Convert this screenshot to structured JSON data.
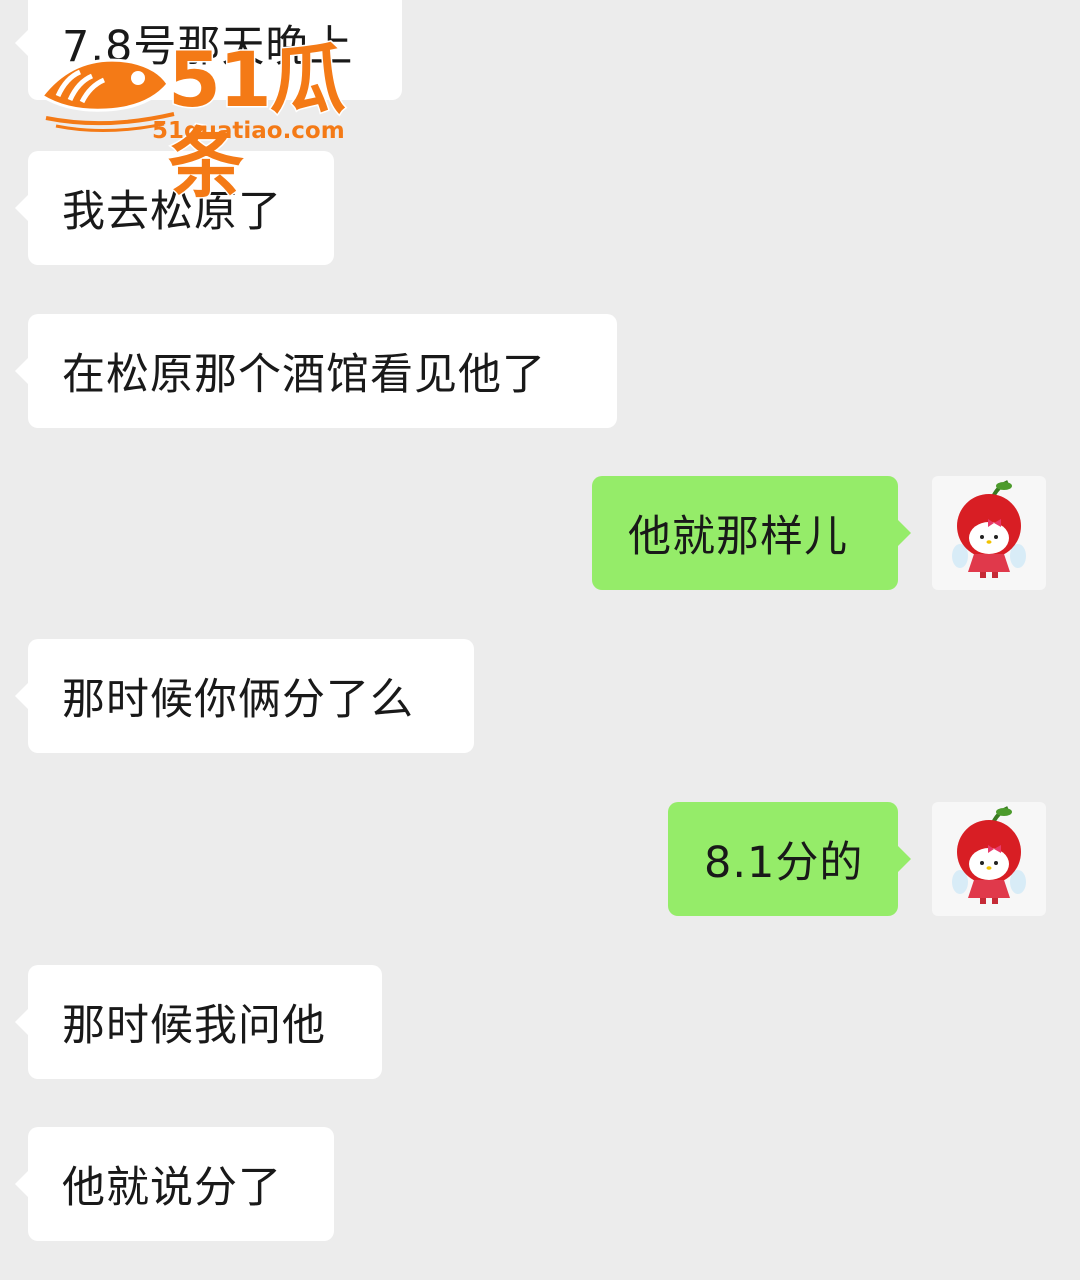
{
  "messages": [
    {
      "side": "incoming",
      "text": "7.8号那天晚上"
    },
    {
      "side": "incoming",
      "text": "我去松原了"
    },
    {
      "side": "incoming",
      "text": "在松原那个酒馆看见他了"
    },
    {
      "side": "outgoing",
      "text": "他就那样儿"
    },
    {
      "side": "incoming",
      "text": "那时候你俩分了么"
    },
    {
      "side": "outgoing",
      "text": "8.1分的"
    },
    {
      "side": "incoming",
      "text": "那时候我问他"
    },
    {
      "side": "incoming",
      "text": "他就说分了"
    }
  ],
  "avatar": {
    "icon": "cherry-kitty-avatar-icon"
  },
  "watermark": {
    "brand": "51瓜条",
    "url": "51guatiao.com",
    "icon": "fish-logo-icon"
  },
  "colors": {
    "background": "#ececec",
    "incoming_bubble": "#ffffff",
    "outgoing_bubble": "#95ec69",
    "watermark": "#f47a16"
  }
}
